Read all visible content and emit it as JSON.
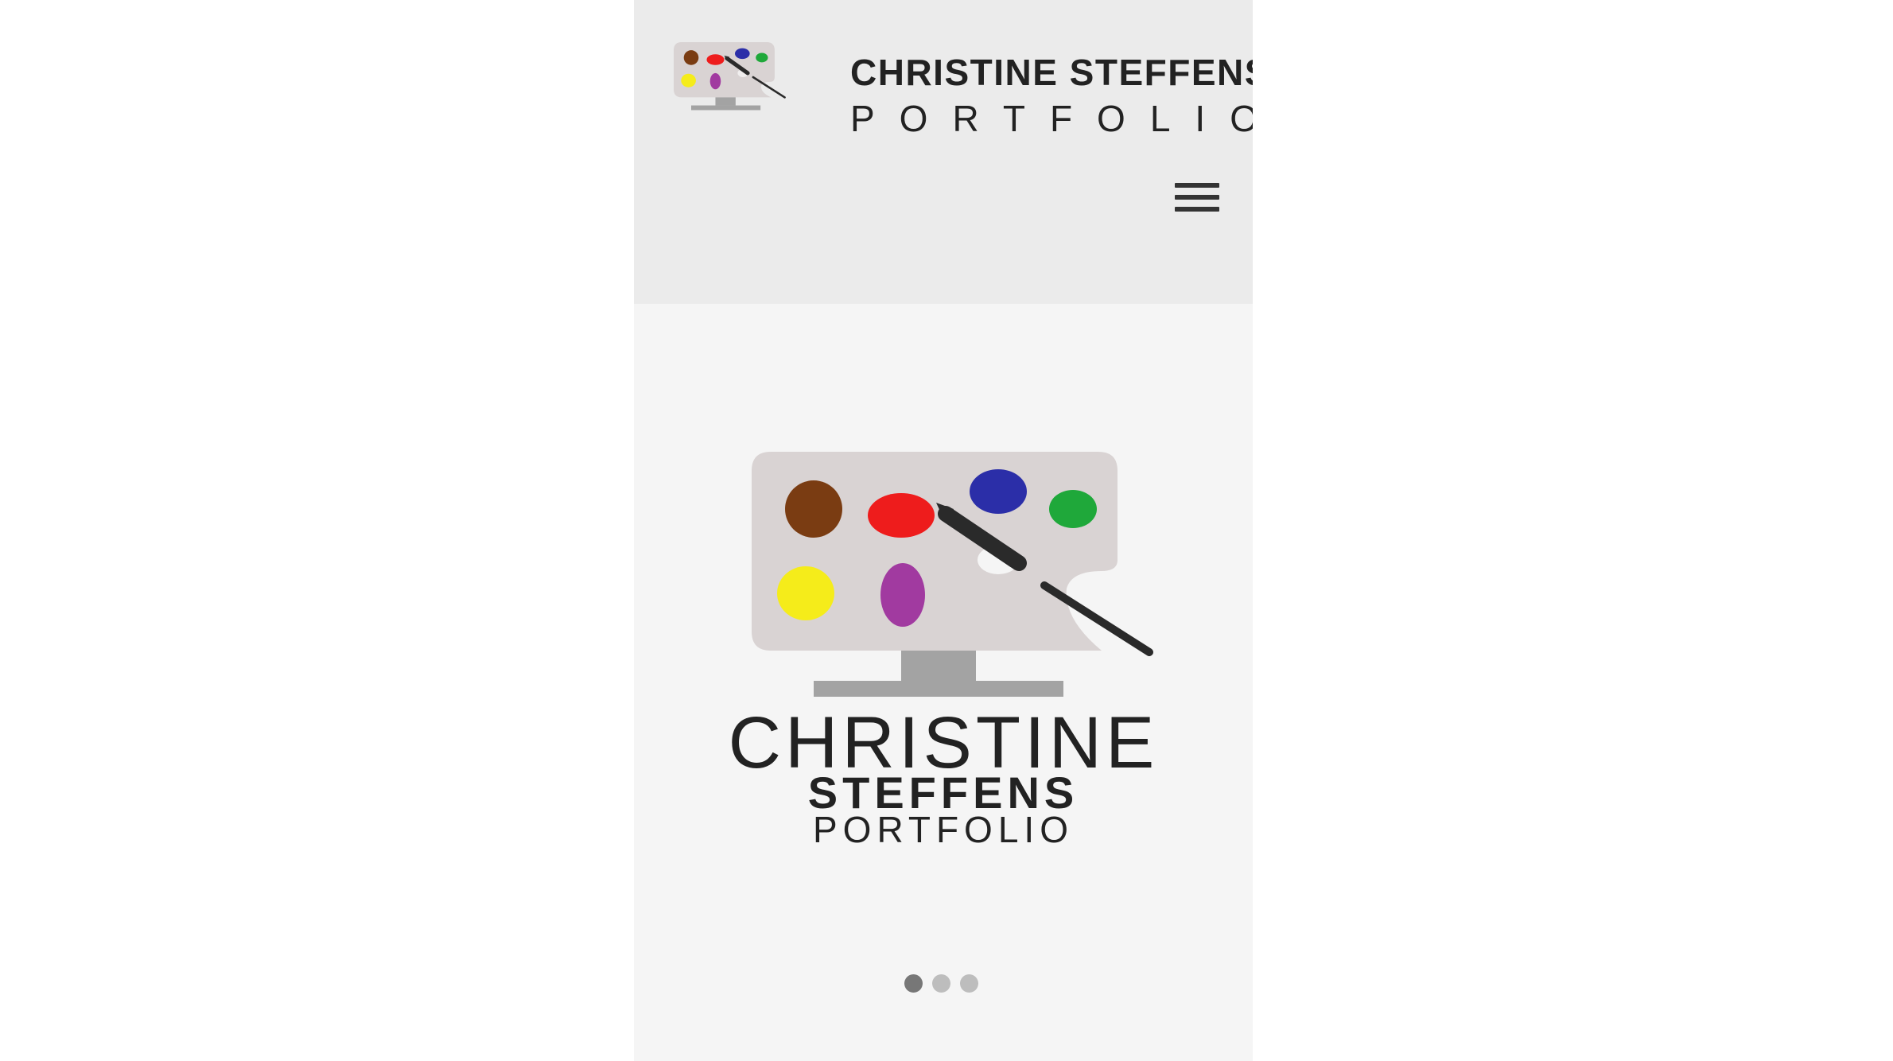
{
  "header": {
    "brand_name": "CHRISTINE STEFFENS",
    "brand_sub": "PORTFOLIO",
    "menu_icon": "hamburger-icon"
  },
  "hero": {
    "name_line1": "CHRISTINE",
    "name_line2": "STEFFENS",
    "name_line3": "PORTFOLIO"
  },
  "carousel": {
    "slide_count": 3,
    "active_index": 0
  },
  "colors": {
    "header_bg": "#ebebeb",
    "page_bg": "#f5f5f5",
    "text": "#222222",
    "palette_board": "#d9d3d3",
    "stand": "#a3a3a3",
    "paint_brown": "#7a3c12",
    "paint_red": "#ee1c1c",
    "paint_blue": "#2b2ea8",
    "paint_green": "#1fa83a",
    "paint_yellow": "#f5ec1a",
    "paint_purple": "#a13aa0",
    "brush": "#2a2a2a"
  }
}
